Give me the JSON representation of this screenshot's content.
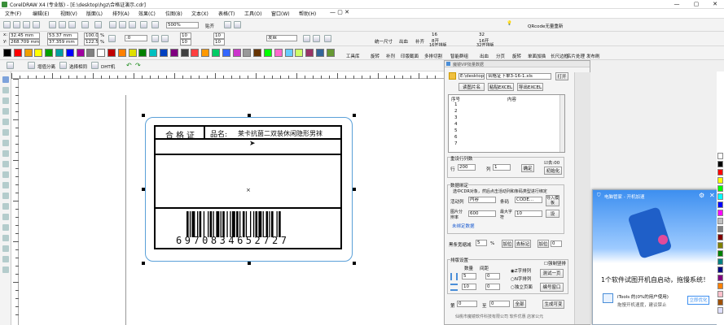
{
  "titlebar": {
    "title": "CorelDRAW X4 (专业版) - [E:\\desktop\\hgz\\合格证演示.cdr]",
    "min": "—",
    "max": "▢",
    "close": "✕"
  },
  "menu": [
    "文件(F)",
    "编辑(E)",
    "视图(V)",
    "版面(L)",
    "排列(A)",
    "效果(C)",
    "位图(B)",
    "文本(X)",
    "表格(T)",
    "工具(O)",
    "窗口(W)",
    "帮助(H)"
  ],
  "toolbar1": {
    "zoom": "500%",
    "snap": "贴齐",
    "qrcode": "QRcode无量重新",
    "labels": [
      "统一尺寸",
      "出血",
      "补齐",
      "16\n8开",
      "32\n16开"
    ],
    "sublabels": [
      "16开排版",
      "32开排版"
    ]
  },
  "props": {
    "x": "32.45 mm",
    "y": "268.709 mm",
    "w": "53.37 mm",
    "h": "37.359 mm",
    "sx": "100.0",
    "sy": "122.5",
    "rot": ".0",
    "n1": "10",
    "n2": "10",
    "outline": "发丝",
    "pct1": "%",
    "pct2": "%"
  },
  "toolbar2": {
    "labels": [
      "工具库",
      "旋转",
      "补剂",
      "印版截面",
      "多排切割",
      "智能群组",
      "出血",
      "分页",
      "旋转",
      "单面加描",
      "长尺边框",
      "名片处理",
      "发布刷"
    ]
  },
  "toolbar3": {
    "items": [
      "增值分离",
      "选择相同",
      "DHT机"
    ]
  },
  "label_card": {
    "title": "合格证",
    "product_label": "品名:",
    "product_name": "莱卡抗菌二双装休闲隐形男袜",
    "barcode": "6970834652727"
  },
  "panel": {
    "title": "魔镜VIP批量数据",
    "path": "E:\\desktop\\h",
    "file": "合格证下单3-16-1.xls",
    "open": "打开",
    "read": "读图片名",
    "paste": "粘贴EXCEL",
    "export": "导出EXCEL",
    "col_no": "序号",
    "col_content": "内容",
    "rows": [
      "1",
      "2",
      "3",
      "4",
      "5",
      "6",
      "7"
    ],
    "reprint": "重设行列数",
    "row_lbl": "行",
    "row_val": "200",
    "col_lbl": "列",
    "col_val": "1",
    "confirm": "确定",
    "remove": "去:00",
    "init": "初始化",
    "data_bind": "数据绑定",
    "hint": "选中CDR对象，然后点击活动列和条码类型进行绑定",
    "active_col": "活动列",
    "active_val": "内容",
    "barcode_lbl": "条码",
    "barcode_val": "CODE...",
    "import_model": "导入模板",
    "img_res": "图片分辨率",
    "res_val": "600",
    "max_lbl": "最大字符",
    "max_val": "10",
    "set": "设",
    "unbound": "未绑定数据",
    "black_lbl": "黑条宽缩减",
    "black_val": "5",
    "pct": "%",
    "add_pos": "加位",
    "del_mark": "去标记",
    "add_num": "加位",
    "num_val": "0",
    "layout": "排版设置",
    "qty": "数量",
    "spacing": "间距",
    "force": "强制竖排",
    "q1": "5",
    "q2": "10",
    "s1": "0",
    "s2": "0",
    "r1": "Z字排列",
    "r2": "N字排列",
    "r3": "独立页面",
    "test": "测试一页",
    "edit_win": "编号窗口",
    "page_lbl": "第",
    "page_from": "0",
    "to": "至",
    "page_to": "0",
    "all": "全部",
    "gen": "生成可变",
    "footer": "仙桃市魔镜软件科技有限公司    软件优惠 店家公元"
  },
  "popup": {
    "title": "电脑管家 - 开机加速",
    "msg": "1个软件试图开机自启动，拖慢系统！",
    "app": "iTools 的(0%的用户使用)",
    "sub": "拖慢开机速度，建议禁止",
    "action": "立即优化"
  },
  "palette_colors": [
    "#ffffff",
    "#000000",
    "#ff0000",
    "#ffff00",
    "#00ff00",
    "#00ffff",
    "#0000ff",
    "#ff00ff",
    "#c0c0c0",
    "#808080",
    "#800000",
    "#808000",
    "#008000",
    "#008080",
    "#000080",
    "#800080",
    "#ff8000",
    "#ffc0cb",
    "#a05000",
    "#e0e0ff"
  ]
}
